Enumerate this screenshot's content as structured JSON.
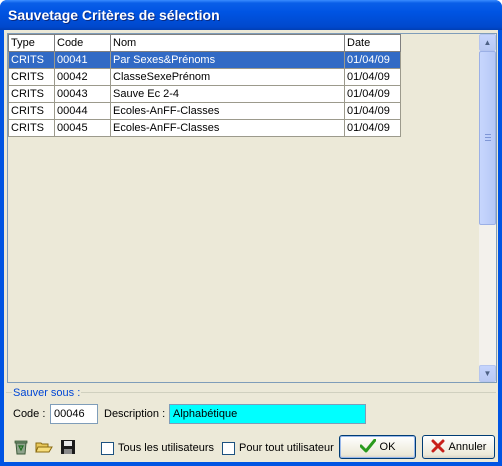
{
  "window": {
    "title": "Sauvetage Critères de sélection"
  },
  "grid": {
    "columns": [
      "Type",
      "Code",
      "Nom",
      "Date"
    ],
    "rows": [
      {
        "type": "CRITS",
        "code": "00041",
        "nom": "Par Sexes&Prénoms",
        "date": "01/04/09",
        "selected": true
      },
      {
        "type": "CRITS",
        "code": "00042",
        "nom": "ClasseSexePrénom",
        "date": "01/04/09"
      },
      {
        "type": "CRITS",
        "code": "00043",
        "nom": "Sauve Ec 2-4",
        "date": "01/04/09"
      },
      {
        "type": "CRITS",
        "code": "00044",
        "nom": "Ecoles-AnFF-Classes",
        "date": "01/04/09"
      },
      {
        "type": "CRITS",
        "code": "00045",
        "nom": "Ecoles-AnFF-Classes",
        "date": "01/04/09"
      }
    ]
  },
  "save_as": {
    "legend": "Sauver sous :",
    "code_label": "Code :",
    "code_value": "00046",
    "description_label": "Description :",
    "description_value": "Alphabétique"
  },
  "options": {
    "all_users_label": "Tous les utilisateurs",
    "any_user_label": "Pour tout utilisateur"
  },
  "buttons": {
    "ok": "OK",
    "cancel": "Annuler"
  },
  "icons": {
    "delete": "recycle-bin-icon",
    "open": "open-folder-icon",
    "save": "floppy-disk-icon"
  },
  "colors": {
    "title_bar": "#0054e3",
    "selection": "#316ac5",
    "description_bg": "#00ffff",
    "legend_text": "#0046d5"
  }
}
